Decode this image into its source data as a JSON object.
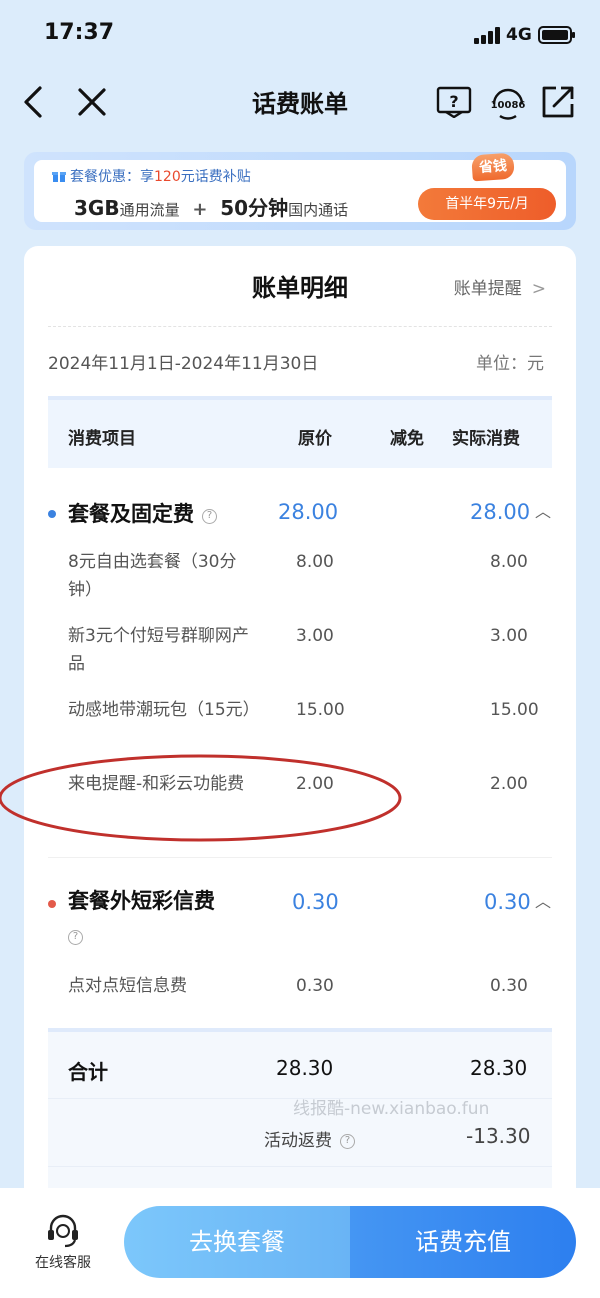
{
  "status_bar": {
    "time": "17:37",
    "network": "4G"
  },
  "nav": {
    "title": "话费账单",
    "service_number": "10086"
  },
  "promo": {
    "tag_prefix": "套餐优惠：享",
    "tag_amount": "120",
    "tag_suffix": "元话费补贴",
    "data_amount": "3GB",
    "data_label": "通用流量",
    "plus": "+",
    "minutes_amount": "50分钟",
    "minutes_label": "国内通话",
    "badge": "省钱",
    "button": "首半年9元/月"
  },
  "bill": {
    "title": "账单明细",
    "remind": "账单提醒",
    "period": "2024年11月1日-2024年11月30日",
    "unit": "单位：元",
    "columns": {
      "name": "消费项目",
      "original": "原价",
      "discount": "减免",
      "actual": "实际消费"
    },
    "groups": [
      {
        "name": "套餐及固定费",
        "dot_color": "#3b82e0",
        "original": "28.00",
        "actual": "28.00",
        "items": [
          {
            "name": "8元自由选套餐（30分钟）",
            "original": "8.00",
            "actual": "8.00"
          },
          {
            "name": "新3元个付短号群聊网产品",
            "original": "3.00",
            "actual": "3.00"
          },
          {
            "name": "动感地带潮玩包（15元）",
            "original": "15.00",
            "actual": "15.00"
          },
          {
            "name": "来电提醒-和彩云功能费",
            "original": "2.00",
            "actual": "2.00"
          }
        ]
      },
      {
        "name": "套餐外短彩信费",
        "dot_color": "#e35a4a",
        "original": "0.30",
        "actual": "0.30",
        "items": [
          {
            "name": "点对点短信息费",
            "original": "0.30",
            "actual": "0.30"
          }
        ]
      }
    ],
    "total": {
      "label": "合计",
      "original": "28.30",
      "actual": "28.30"
    },
    "rebate": {
      "label": "活动返费",
      "value": "-13.30"
    }
  },
  "watermark": "线报酷-new.xianbao.fun",
  "bottom_bar": {
    "service_label": "在线客服",
    "change_button": "去换套餐",
    "topup_button": "话费充值"
  },
  "colors": {
    "accent": "#3b82e0",
    "promo_orange": "#ee5d2a",
    "annotation_red": "#c0302c"
  }
}
